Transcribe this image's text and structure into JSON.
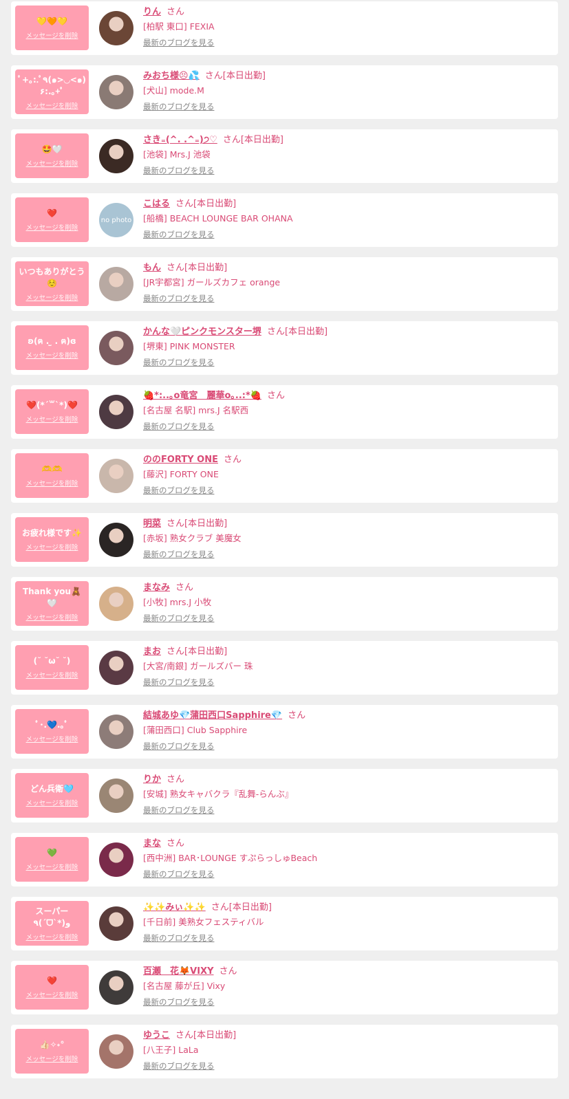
{
  "delete_label": "メッセージを削除",
  "san_label": "さん",
  "blog_label": "最新のブログを見る",
  "colors": {
    "accent": "#d94a75",
    "bubble": "#ff9fb1",
    "background": "#efefef"
  },
  "items": [
    {
      "message": "💛🧡💛",
      "name": "りん",
      "status": "",
      "shop": "[柏駅 東口] FEXIA",
      "avatar_color": "#6b4636"
    },
    {
      "message": "ﾟ+｡:.ﾟ٩(๑>◡<๑)۶:.｡+ﾟ",
      "name": "みおち様😣💦",
      "status": "[本日出勤]",
      "shop": "[犬山] mode.M",
      "avatar_color": "#8a7a74"
    },
    {
      "message": "🤩🤍",
      "name": "さき₌(^. .^₌)੭♡",
      "status": "[本日出勤]",
      "shop": "[池袋] Mrs.J 池袋",
      "avatar_color": "#3b2a24"
    },
    {
      "message": "❤️",
      "name": "こはる",
      "status": "[本日出勤]",
      "shop": "[船橋] BEACH LOUNGE BAR OHANA",
      "avatar_color": "#a9c4d4",
      "avatar_text": "no photo"
    },
    {
      "message": "いつもありがとう☺️",
      "name": "もん",
      "status": "[本日出勤]",
      "shop": "[JR宇都宮] ガールズカフェ orange",
      "avatar_color": "#b8a9a2"
    },
    {
      "message": "ʚ(ฅ︎ . ̫ . ฅ︎)ɞ",
      "name": "かんな🤍ピンクモンスター堺",
      "status": "[本日出勤]",
      "shop": "[堺東] PINK MONSTER",
      "avatar_color": "#7a5a5e"
    },
    {
      "message": "❤️(*´꒳`*)❤️",
      "name": "🍓*:..｡o竜宮　麗華o｡..:*🍓",
      "status": "",
      "shop": "[名古屋 名駅] mrs.J 名駅西",
      "avatar_color": "#4e3a42"
    },
    {
      "message": "🫶🫶",
      "name": "ののFORTY ONE",
      "status": "",
      "shop": "[藤沢] FORTY ONE",
      "avatar_color": "#c9b7ab"
    },
    {
      "message": "お疲れ様です✨",
      "name": "明菜",
      "status": "[本日出勤]",
      "shop": "[赤坂] 熟女クラブ 美魔女",
      "avatar_color": "#2a2524"
    },
    {
      "message": "Thank you🧸🤍",
      "name": "まなみ",
      "status": "",
      "shop": "[小牧] mrs.J 小牧",
      "avatar_color": "#d6b08a"
    },
    {
      "message": "(˘ ˘ω˘ ˘)",
      "name": "まお",
      "status": "[本日出勤]",
      "shop": "[大宮/南銀] ガールズバー 珠",
      "avatar_color": "#5a3a44"
    },
    {
      "message": "ﾟ･.💙.｡ﾟ",
      "name": "結城あゆ💎蒲田西口Sapphire💎",
      "status": "",
      "shop": "[蒲田西口] Club Sapphire",
      "avatar_color": "#8d7c78"
    },
    {
      "message": "どん兵衛🩵",
      "name": "りか",
      "status": "",
      "shop": "[安城] 熟女キャバクラ『乱舞-らんぶ』",
      "avatar_color": "#9a8674"
    },
    {
      "message": "💚",
      "name": "まな",
      "status": "",
      "shop": "[西中洲] BAR･LOUNGE すぷらっしゅBeach",
      "avatar_color": "#7a2a4a"
    },
    {
      "message": "スーパー\n٩(ˊᗜˋ*)و",
      "name": "✨✨みぃ✨✨",
      "status": "[本日出勤]",
      "shop": "[千日前] 美熟女フェスティバル",
      "avatar_color": "#5a3c3a"
    },
    {
      "message": "❤️",
      "name": "百瀬　花🦊VIXY",
      "status": "",
      "shop": "[名古屋 藤が丘] Vixy",
      "avatar_color": "#3f3b3a"
    },
    {
      "message": "👍🏻✧˖°",
      "name": "ゆうこ",
      "status": "[本日出勤]",
      "shop": "[八王子] LaLa",
      "avatar_color": "#a4746a"
    }
  ]
}
